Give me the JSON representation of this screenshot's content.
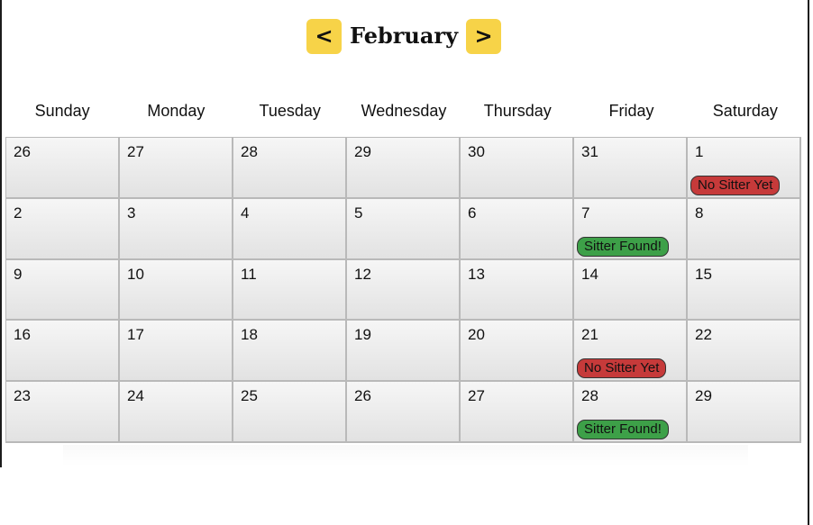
{
  "header": {
    "prev_label": "<",
    "next_label": ">",
    "month": "February"
  },
  "weekdays": [
    "Sunday",
    "Monday",
    "Tuesday",
    "Wednesday",
    "Thursday",
    "Friday",
    "Saturday"
  ],
  "weeks": [
    [
      {
        "day": "26"
      },
      {
        "day": "27"
      },
      {
        "day": "28"
      },
      {
        "day": "29"
      },
      {
        "day": "30"
      },
      {
        "day": "31"
      },
      {
        "day": "1",
        "badge": "No Sitter Yet",
        "status": "none"
      }
    ],
    [
      {
        "day": "2"
      },
      {
        "day": "3"
      },
      {
        "day": "4"
      },
      {
        "day": "5"
      },
      {
        "day": "6"
      },
      {
        "day": "7",
        "badge": "Sitter Found!",
        "status": "found"
      },
      {
        "day": "8"
      }
    ],
    [
      {
        "day": "9"
      },
      {
        "day": "10"
      },
      {
        "day": "11"
      },
      {
        "day": "12"
      },
      {
        "day": "13"
      },
      {
        "day": "14"
      },
      {
        "day": "15"
      }
    ],
    [
      {
        "day": "16"
      },
      {
        "day": "17"
      },
      {
        "day": "18"
      },
      {
        "day": "19"
      },
      {
        "day": "20"
      },
      {
        "day": "21",
        "badge": "No Sitter Yet",
        "status": "none"
      },
      {
        "day": "22"
      }
    ],
    [
      {
        "day": "23"
      },
      {
        "day": "24"
      },
      {
        "day": "25"
      },
      {
        "day": "26"
      },
      {
        "day": "27"
      },
      {
        "day": "28",
        "badge": "Sitter Found!",
        "status": "found"
      },
      {
        "day": "29"
      }
    ]
  ],
  "colors": {
    "nav_button": "#f7d348",
    "no_sitter": "#c63a3a",
    "sitter_found": "#3da048"
  }
}
